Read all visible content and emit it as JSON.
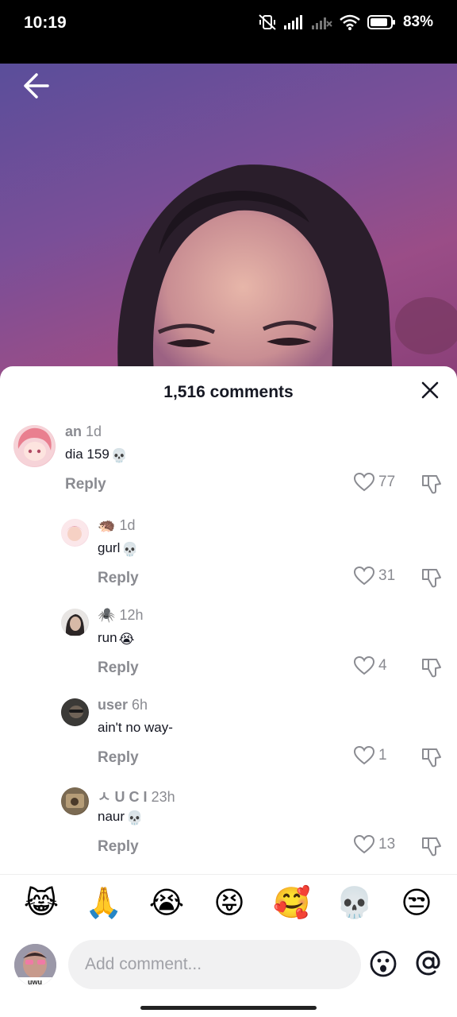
{
  "status_bar": {
    "time": "10:19",
    "battery": "83%"
  },
  "sheet": {
    "title": "1,516 comments"
  },
  "comments": [
    {
      "user": "an",
      "age": "1d",
      "text": "dia 159",
      "emoji": "💀",
      "reply": "Reply",
      "likes": "77"
    },
    {
      "user": "🦔",
      "age": "1d",
      "text": "gurl",
      "emoji": "💀",
      "reply": "Reply",
      "likes": "31"
    },
    {
      "user": "🕷️",
      "age": "12h",
      "text": "run",
      "emoji": "😭",
      "reply": "Reply",
      "likes": "4"
    },
    {
      "user": "user",
      "age": "6h",
      "text": "ain't no way-",
      "emoji": "",
      "reply": "Reply",
      "likes": "1"
    },
    {
      "user": "ㅅ U C I",
      "age": "23h",
      "text": "naur",
      "emoji": "💀",
      "reply": "Reply",
      "likes": "13"
    }
  ],
  "emoji_bar": [
    "😹",
    "🙏",
    "😭",
    "😝",
    "🥰",
    "💀",
    "😒"
  ],
  "input": {
    "placeholder": "Add comment..."
  },
  "my_avatar_label": "uwu",
  "colors": {
    "secondary_text": "#8a8b91",
    "primary_text": "#161823",
    "input_bg": "#f1f1f2"
  }
}
